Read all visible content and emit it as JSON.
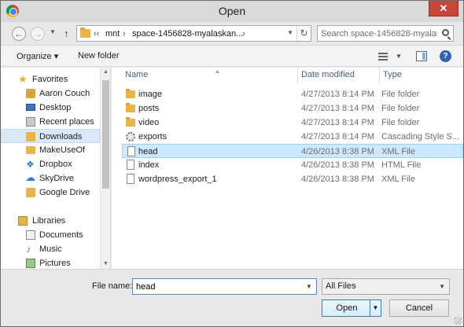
{
  "window": {
    "title": "Open",
    "close_glyph": "✕"
  },
  "nav": {
    "back_glyph": "←",
    "forward_glyph": "→",
    "up_glyph": "↑",
    "address": {
      "overflow": "‹‹",
      "crumbs": [
        "mnt",
        "space-1456828-myalaskan..."
      ],
      "separator": "›"
    },
    "refresh_glyph": "↻",
    "search_placeholder": "Search space-1456828-myalas..."
  },
  "toolbar": {
    "organize": "Organize ▾",
    "new_folder": "New folder",
    "help": "?"
  },
  "sidebar": {
    "items": [
      {
        "label": "Favorites",
        "icon": "star-icon",
        "color": "#e8b22c"
      },
      {
        "label": "Aaron Couch",
        "icon": "user-folder-icon",
        "color": "#d9a43a"
      },
      {
        "label": "Desktop",
        "icon": "desktop-icon",
        "color": "#3a76c4"
      },
      {
        "label": "Recent places",
        "icon": "recent-icon",
        "color": "#9a9a9a"
      },
      {
        "label": "Downloads",
        "icon": "download-icon",
        "color": "#3a76c4"
      },
      {
        "label": "MakeUseOf",
        "icon": "folder-icon",
        "color": "#e6b54a"
      },
      {
        "label": "Dropbox",
        "icon": "dropbox-icon",
        "color": "#2b7ed6"
      },
      {
        "label": "SkyDrive",
        "icon": "cloud-icon",
        "color": "#2b7ed6"
      },
      {
        "label": "Google Drive",
        "icon": "drive-icon",
        "color": "#e6b54a"
      },
      {
        "label": "Libraries",
        "icon": "libraries-icon",
        "color": "#e6b54a"
      },
      {
        "label": "Documents",
        "icon": "documents-icon",
        "color": "#c7c7c7"
      },
      {
        "label": "Music",
        "icon": "music-icon",
        "color": "#3a76c4"
      },
      {
        "label": "Pictures",
        "icon": "pictures-icon",
        "color": "#6aa64a"
      }
    ]
  },
  "columns": {
    "name": "Name",
    "date": "Date modified",
    "type": "Type"
  },
  "files": [
    {
      "name": "image",
      "date": "4/27/2013 8:14 PM",
      "type": "File folder",
      "icon": "folder-icon"
    },
    {
      "name": "posts",
      "date": "4/27/2013 8:14 PM",
      "type": "File folder",
      "icon": "folder-icon"
    },
    {
      "name": "video",
      "date": "4/27/2013 8:14 PM",
      "type": "File folder",
      "icon": "folder-icon"
    },
    {
      "name": "exports",
      "date": "4/27/2013 8:14 PM",
      "type": "Cascading Style S...",
      "icon": "css-file-icon"
    },
    {
      "name": "head",
      "date": "4/26/2013 8:38 PM",
      "type": "XML File",
      "icon": "file-icon"
    },
    {
      "name": "index",
      "date": "4/26/2013 8:38 PM",
      "type": "HTML File",
      "icon": "file-icon"
    },
    {
      "name": "wordpress_export_1",
      "date": "4/26/2013 8:38 PM",
      "type": "XML File",
      "icon": "file-icon"
    }
  ],
  "footer": {
    "filename_label": "File name:",
    "filename_value": "head",
    "filetype_value": "All Files",
    "open_label": "Open",
    "cancel_label": "Cancel"
  }
}
